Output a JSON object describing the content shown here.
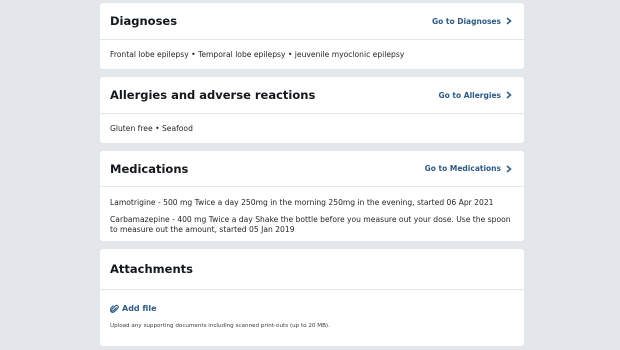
{
  "diagnoses": {
    "title": "Diagnoses",
    "link": "Go to Diagnoses",
    "items": "Frontal lobe epilepsy • Temporal lobe epilepsy • jeuvenile myoclonic epilepsy"
  },
  "allergies": {
    "title": "Allergies and adverse reactions",
    "link": "Go to Allergies",
    "items": "Gluten free • Seafood"
  },
  "medications": {
    "title": "Medications",
    "link": "Go to Medications",
    "items": [
      "Lamotrigine - 500 mg Twice a day 250mg in the morning 250mg in the evening, started 06 Apr 2021",
      "Carbamazepine - 400 mg Twice a day Shake the bottle before you measure out your dose. Use the spoon to measure out the amount, started 05 Jan 2019"
    ]
  },
  "attachments": {
    "title": "Attachments",
    "add_label": "Add file",
    "hint": "Upload any supporting documents including scanned print-outs (up to 20 MB)."
  },
  "icons": {
    "chevron": "chevron-right-icon",
    "paperclip": "paperclip-icon"
  }
}
